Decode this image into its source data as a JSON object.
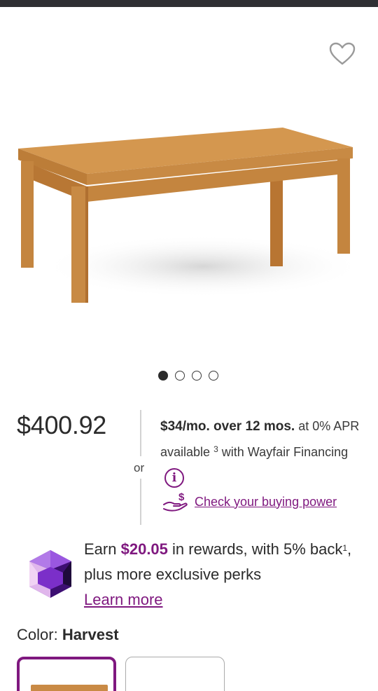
{
  "product": {
    "price": "$400.92",
    "image_count": 4,
    "active_image_index": 0
  },
  "financing": {
    "monthly": "$34/mo. over 12 mos.",
    "rate_text": "at 0% APR available",
    "footnote": "3",
    "provider_text": "with Wayfair Financing",
    "or_label": "or",
    "buying_power_link": "Check your buying power"
  },
  "rewards": {
    "earn_prefix": "Earn",
    "amount": "$20.05",
    "earn_suffix": "in rewards, with 5% back",
    "footnote": "1",
    "perks_text": ", plus more exclusive perks",
    "learn_more": "Learn more"
  },
  "color": {
    "label": "Color:",
    "value": "Harvest"
  },
  "colors": {
    "accent": "#7f187f",
    "text": "#2b2b2b",
    "wood": "#c98a45",
    "gem": "#7b2fc9"
  }
}
